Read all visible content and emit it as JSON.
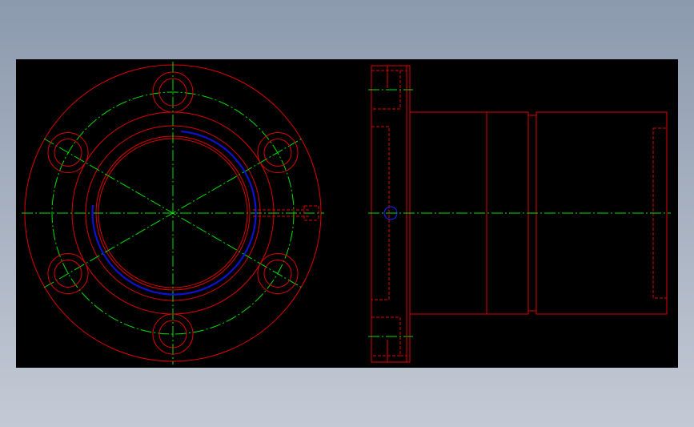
{
  "drawing": {
    "views": [
      "front-view",
      "side-view"
    ],
    "colors": {
      "background": "#000000",
      "outline": "#e00000",
      "centerline": "#00e000",
      "hidden": "#e00000",
      "highlight": "#0000dd"
    },
    "bolt_hole_count": 6
  }
}
